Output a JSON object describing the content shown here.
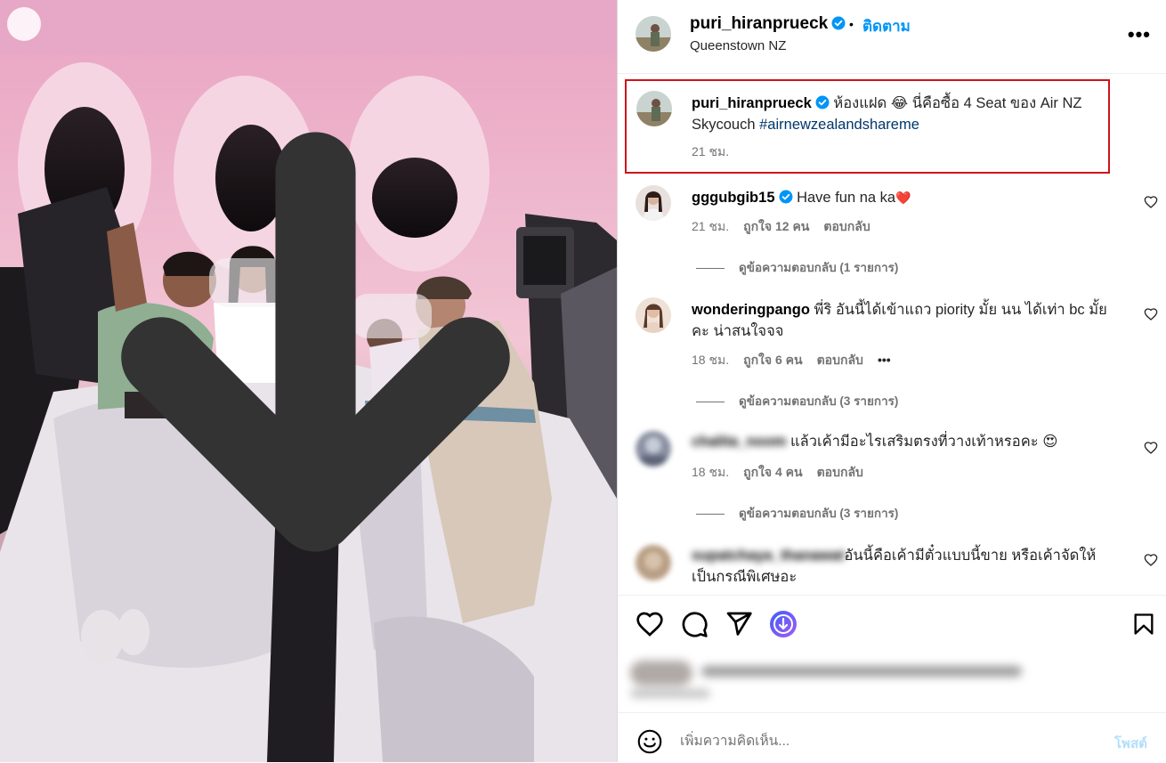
{
  "header": {
    "username": "puri_hiranprueck",
    "separator": "•",
    "follow_label": "ติดตาม",
    "location": "Queenstown NZ",
    "more_label": "•••"
  },
  "caption": {
    "username": "puri_hiranprueck",
    "text_1": " ห้องแฝด ",
    "emoji": "😂",
    "text_2": " นี่คือซื้อ 4 Seat ของ Air NZ Skycouch ",
    "hashtag": "#airnewzealandshareme",
    "time": "21 ชม."
  },
  "comments": [
    {
      "username": "gggubgib15",
      "text": "Have fun na ka",
      "emoji": "❤️",
      "time": "21 ชม.",
      "likes": "ถูกใจ 12 คน",
      "reply_label": "ตอบกลับ",
      "view_replies": "ดูข้อความตอบกลับ (1 รายการ)"
    },
    {
      "username": "wonderingpango",
      "text": "พี่ริ อันนี้ได้เข้าแถว piority มั้ย นน ได้เท่า bc มั้ยคะ น่าสนใจจจ",
      "time": "18 ชม.",
      "likes": "ถูกใจ 6 คน",
      "reply_label": "ตอบกลับ",
      "more": "•••",
      "view_replies": "ดูข้อความตอบกลับ (3 รายการ)"
    },
    {
      "username": "chalita_noom",
      "text": "แล้วเค้ามีอะไรเสริมตรงที่วางเท้าหรอคะ",
      "emoji": "😍",
      "time": "18 ชม.",
      "likes": "ถูกใจ 4 คน",
      "reply_label": "ตอบกลับ",
      "view_replies": "ดูข้อความตอบกลับ (3 รายการ)"
    },
    {
      "username": "supatchaya_thanawat",
      "text": "อันนี้คือเค้ามีตั๋วแบบนี้ขาย หรือเค้าจัดให้เป็นกรณีพิเศษอะ"
    }
  ],
  "likes_summary_blurred": "ถูกใจโดย kanok.kanok และคนอื่นๆ อีก 23,567 คน",
  "likes_date_blurred": "21 ชั่วโมง",
  "add_comment": {
    "placeholder": "เพิ่มความคิดเห็น...",
    "post_label": "โพสต์"
  },
  "colors": {
    "accent_blue": "#0095f6",
    "highlight_red": "#d0121b",
    "hashtag": "#00376b",
    "muted": "#737373"
  },
  "icons": [
    "download-icon",
    "verified-icon",
    "more-icon",
    "heart-icon",
    "comment-icon",
    "share-icon",
    "save-icon",
    "emoji-icon"
  ]
}
